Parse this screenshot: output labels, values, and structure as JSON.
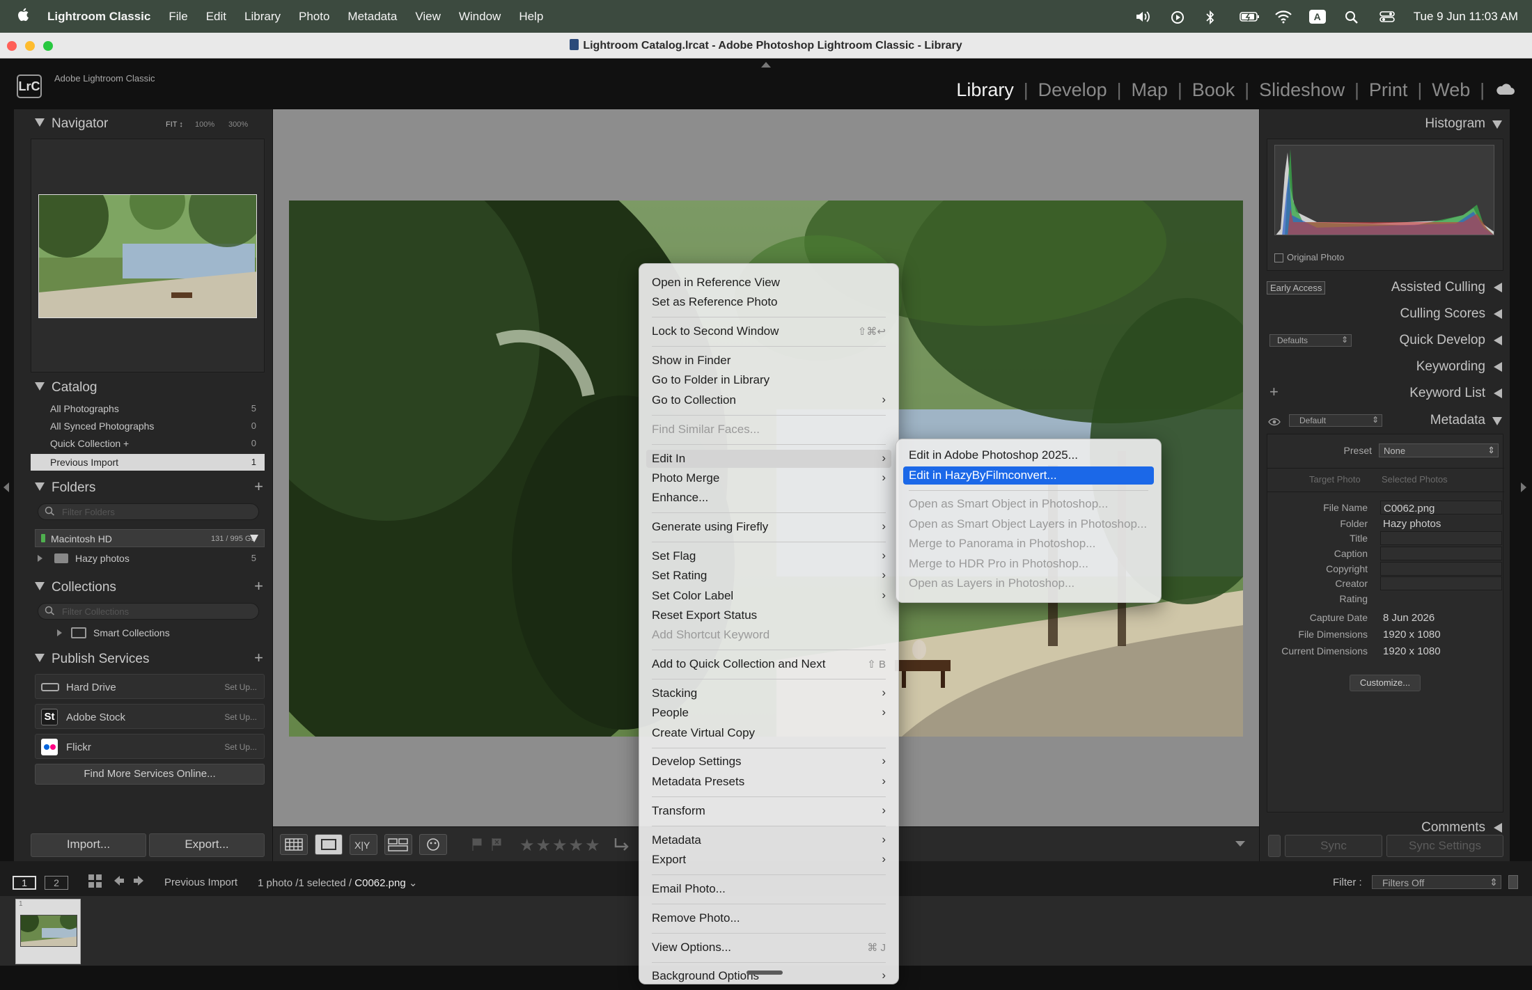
{
  "menubar": {
    "app": "Lightroom Classic",
    "items": [
      "File",
      "Edit",
      "Library",
      "Photo",
      "Metadata",
      "View",
      "Window",
      "Help"
    ],
    "clock": "Tue 9 Jun  11:03 AM",
    "input_source": "A"
  },
  "window": {
    "title": "Lightroom Catalog.lrcat - Adobe Photoshop Lightroom Classic - Library"
  },
  "header": {
    "logo": "LrC",
    "app_name": "Adobe Lightroom Classic",
    "modules": [
      "Library",
      "Develop",
      "Map",
      "Book",
      "Slideshow",
      "Print",
      "Web"
    ],
    "active_module": "Library"
  },
  "navigator": {
    "title": "Navigator",
    "zoom": [
      "FIT ↕",
      "100%",
      "300%"
    ]
  },
  "catalog": {
    "title": "Catalog",
    "items": [
      {
        "label": "All Photographs",
        "count": "5"
      },
      {
        "label": "All Synced Photographs",
        "count": "0"
      },
      {
        "label": "Quick Collection +",
        "count": "0"
      },
      {
        "label": "Previous Import",
        "count": "1"
      }
    ]
  },
  "folders": {
    "title": "Folders",
    "filter_placeholder": "Filter Folders",
    "volume": {
      "label": "Macintosh HD",
      "size": "131 / 995 GB"
    },
    "items": [
      {
        "label": "Hazy photos",
        "count": "5"
      }
    ]
  },
  "collections": {
    "title": "Collections",
    "filter_placeholder": "Filter Collections",
    "items": [
      {
        "label": "Smart Collections"
      }
    ]
  },
  "publish": {
    "title": "Publish Services",
    "services": [
      {
        "label": "Hard Drive",
        "action": "Set Up..."
      },
      {
        "label": "Adobe Stock",
        "action": "Set Up...",
        "badge": "St"
      },
      {
        "label": "Flickr",
        "action": "Set Up..."
      }
    ],
    "find_more": "Find More Services Online..."
  },
  "left_buttons": {
    "import": "Import...",
    "export": "Export..."
  },
  "histogram": {
    "title": "Histogram",
    "original_photo": "Original Photo"
  },
  "right_panels": {
    "early_access": "Early Access",
    "assisted_culling": "Assisted Culling",
    "culling_scores": "Culling Scores",
    "quick_develop": "Quick Develop",
    "quick_develop_preset": "Defaults",
    "keywording": "Keywording",
    "keyword_list": "Keyword List",
    "metadata": "Metadata",
    "metadata_preset": "Default",
    "comments": "Comments"
  },
  "metadata": {
    "preset_label": "Preset",
    "preset_value": "None",
    "target_photo": "Target Photo",
    "selected_photos": "Selected Photos",
    "fields": [
      {
        "k": "File Name",
        "v": "C0062.png",
        "box": true
      },
      {
        "k": "Folder",
        "v": "Hazy photos",
        "box": false
      },
      {
        "k": "Title",
        "v": "",
        "box": true
      },
      {
        "k": "Caption",
        "v": "",
        "box": true
      },
      {
        "k": "Copyright",
        "v": "",
        "box": true
      },
      {
        "k": "Creator",
        "v": "",
        "box": true
      },
      {
        "k": "Rating",
        "v": "",
        "box": false
      },
      {
        "k": "Capture Date",
        "v": "8 Jun 2026",
        "box": false
      },
      {
        "k": "File Dimensions",
        "v": "1920 x 1080",
        "box": false
      },
      {
        "k": "Current Dimensions",
        "v": "1920 x 1080",
        "box": false
      }
    ],
    "customize": "Customize..."
  },
  "sync": {
    "sync": "Sync",
    "sync_settings": "Sync Settings"
  },
  "filmbar": {
    "monitor1": "1",
    "monitor2": "2",
    "source": "Previous Import",
    "count_text": "1 photo /1 selected /",
    "filename": "C0062.png",
    "filter_label": "Filter :",
    "filter_value": "Filters Off"
  },
  "filmstrip": {
    "thumb_index": "1"
  },
  "context_menu": {
    "items": [
      {
        "label": "Open in Reference View"
      },
      {
        "label": "Set as Reference Photo"
      },
      {
        "sep": true
      },
      {
        "label": "Lock to Second Window",
        "shortcut": "⇧⌘↩"
      },
      {
        "sep": true
      },
      {
        "label": "Show in Finder"
      },
      {
        "label": "Go to Folder in Library"
      },
      {
        "label": "Go to Collection",
        "sub": true
      },
      {
        "sep": true
      },
      {
        "label": "Find Similar Faces...",
        "disabled": true
      },
      {
        "sep": true
      },
      {
        "label": "Edit In",
        "sub": true,
        "hover": true
      },
      {
        "label": "Photo Merge",
        "sub": true
      },
      {
        "label": "Enhance..."
      },
      {
        "sep": true
      },
      {
        "label": "Generate using Firefly",
        "sub": true
      },
      {
        "sep": true
      },
      {
        "label": "Set Flag",
        "sub": true
      },
      {
        "label": "Set Rating",
        "sub": true
      },
      {
        "label": "Set Color Label",
        "sub": true
      },
      {
        "label": "Reset Export Status"
      },
      {
        "label": "Add Shortcut Keyword",
        "disabled": true
      },
      {
        "sep": true
      },
      {
        "label": "Add to Quick Collection and Next",
        "shortcut": "⇧ B"
      },
      {
        "sep": true
      },
      {
        "label": "Stacking",
        "sub": true
      },
      {
        "label": "People",
        "sub": true
      },
      {
        "label": "Create Virtual Copy"
      },
      {
        "sep": true
      },
      {
        "label": "Develop Settings",
        "sub": true
      },
      {
        "label": "Metadata Presets",
        "sub": true
      },
      {
        "sep": true
      },
      {
        "label": "Transform",
        "sub": true
      },
      {
        "sep": true
      },
      {
        "label": "Metadata",
        "sub": true
      },
      {
        "label": "Export",
        "sub": true
      },
      {
        "sep": true
      },
      {
        "label": "Email Photo..."
      },
      {
        "sep": true
      },
      {
        "label": "Remove Photo..."
      },
      {
        "sep": true
      },
      {
        "label": "View Options...",
        "shortcut": "⌘ J"
      },
      {
        "sep": true
      },
      {
        "label": "Background Options",
        "sub": true
      }
    ]
  },
  "submenu": {
    "items": [
      {
        "label": "Edit in Adobe Photoshop 2025..."
      },
      {
        "label": "Edit in HazyByFilmconvert...",
        "selected": true
      },
      {
        "sep": true
      },
      {
        "label": "Open as Smart Object in Photoshop...",
        "disabled": true
      },
      {
        "label": "Open as Smart Object Layers in Photoshop...",
        "disabled": true
      },
      {
        "label": "Merge to Panorama in Photoshop...",
        "disabled": true
      },
      {
        "label": "Merge to HDR Pro in Photoshop...",
        "disabled": true
      },
      {
        "label": "Open as Layers in Photoshop...",
        "disabled": true
      }
    ]
  }
}
